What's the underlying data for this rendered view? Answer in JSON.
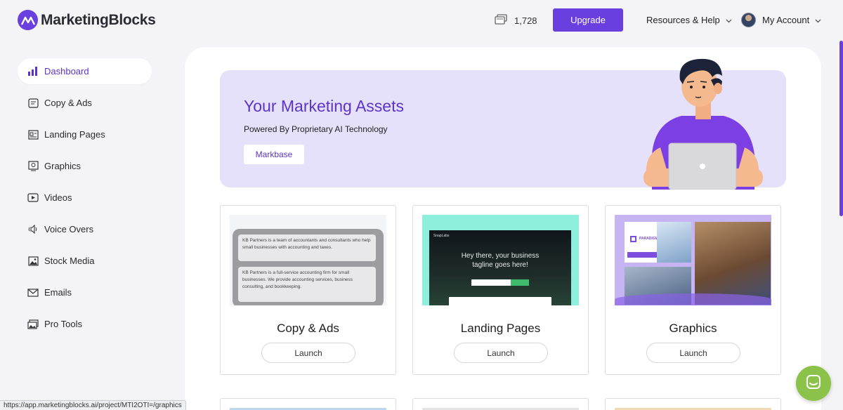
{
  "brand": {
    "name": "MarketingBlocks",
    "accent": "#6a3fe0"
  },
  "header": {
    "credits_value": "1,728",
    "upgrade_label": "Upgrade",
    "resources_label": "Resources & Help",
    "account_label": "My Account"
  },
  "sidebar": {
    "items": [
      {
        "label": "Dashboard",
        "icon": "bar-chart-icon",
        "active": true
      },
      {
        "label": "Copy & Ads",
        "icon": "document-icon"
      },
      {
        "label": "Landing Pages",
        "icon": "page-layout-icon"
      },
      {
        "label": "Graphics",
        "icon": "image-frame-icon"
      },
      {
        "label": "Videos",
        "icon": "play-icon"
      },
      {
        "label": "Voice Overs",
        "icon": "speaker-icon"
      },
      {
        "label": "Stock Media",
        "icon": "photo-icon"
      },
      {
        "label": "Emails",
        "icon": "envelope-icon"
      },
      {
        "label": "Pro Tools",
        "icon": "tools-icon"
      }
    ]
  },
  "hero": {
    "title": "Your Marketing Assets",
    "subtitle": "Powered By Proprietary AI Technology",
    "button_label": "Markbase"
  },
  "cards": [
    {
      "title": "Copy & Ads",
      "launch_label": "Launch",
      "preview_text_1": "KB Partners is a team of accountants and consultants who help small businesses with accounting and taxes.",
      "preview_text_2": "KB Partners is a full-service accounting firm for small businesses. We provide accounting services, business consulting, and bookkeeping."
    },
    {
      "title": "Landing Pages",
      "launch_label": "Launch",
      "preview_brand": "SnapLabs",
      "preview_headline": "Hey there, your business tagline goes here!"
    },
    {
      "title": "Graphics",
      "launch_label": "Launch",
      "preview_brand": "PARADIGM"
    }
  ],
  "status_url": "https://app.marketingblocks.ai/project/MTI2OTI=/graphics"
}
